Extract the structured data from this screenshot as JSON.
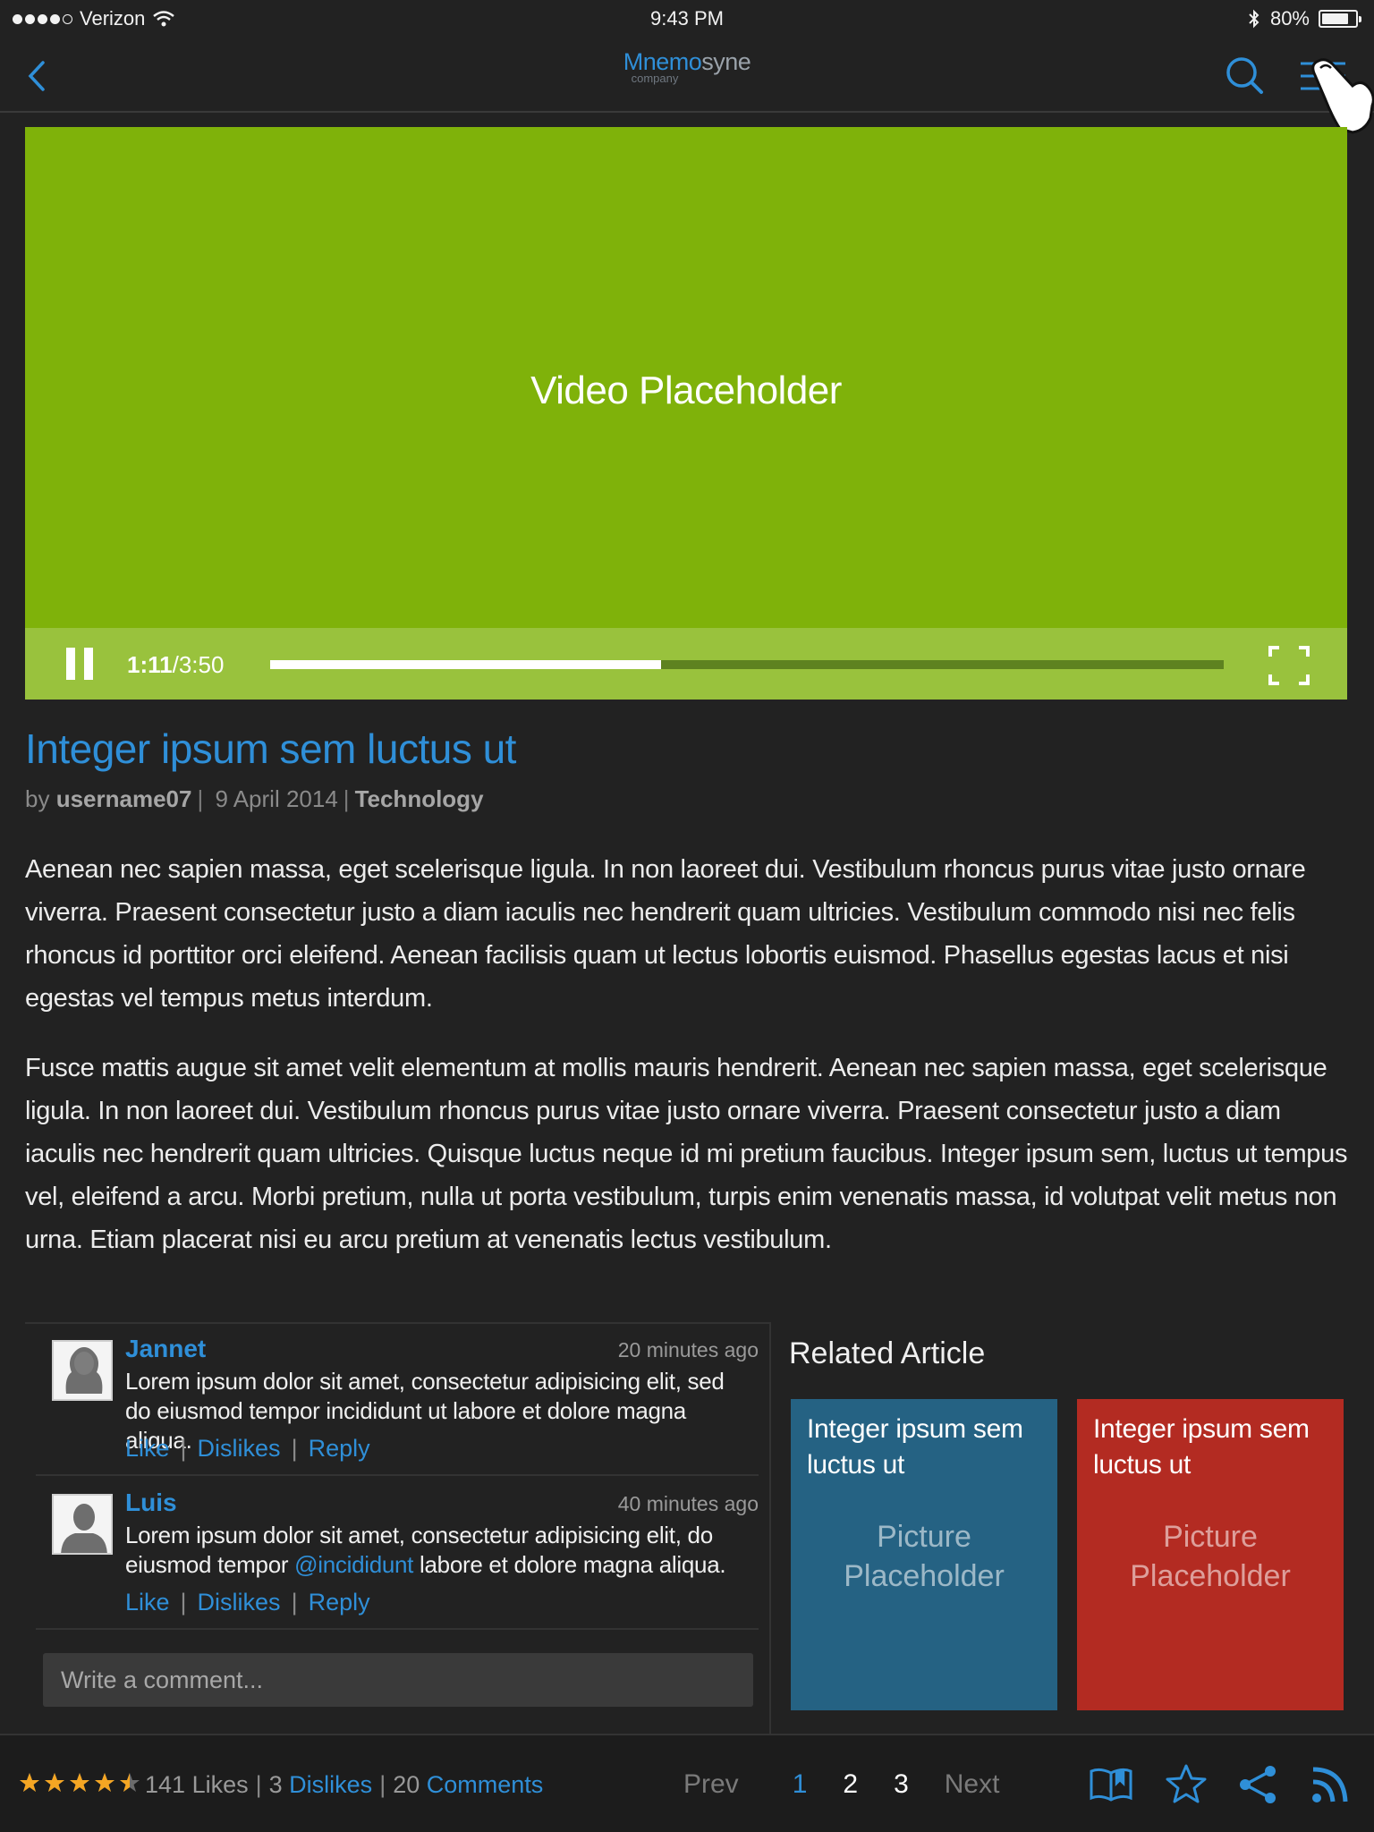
{
  "status_bar": {
    "carrier": "Verizon",
    "time": "9:43 PM",
    "battery": "80%",
    "battery_level": 0.8,
    "icons": [
      "wifi-icon",
      "bluetooth-icon",
      "battery-icon"
    ]
  },
  "nav": {
    "logo_part1": "Mnemo",
    "logo_part2": "syne",
    "logo_sub": "company",
    "icons": [
      "back-chevron-icon",
      "search-icon",
      "hamburger-menu-icon",
      "pointing-hand-icon"
    ]
  },
  "video": {
    "label": "Video Placeholder",
    "current_time": "1:11",
    "duration": "/3:50",
    "progress": 0.41,
    "background_color": "#7fb20a"
  },
  "article": {
    "title": "Integer ipsum sem luctus ut",
    "by": "by",
    "author": "username07",
    "date": "9 April 2014",
    "category": "Technology",
    "paragraphs": [
      "Aenean nec sapien massa, eget scelerisque ligula. In non laoreet dui. Vestibulum rhoncus purus vitae justo ornare viverra. Praesent consectetur justo a diam iaculis nec hendrerit quam ultricies. Vestibulum commodo nisi nec felis rhoncus id porttitor orci eleifend. Aenean facilisis quam ut lectus lobortis euismod. Phasellus egestas lacus et nisi egestas vel tempus metus interdum.",
      "Fusce mattis augue sit amet velit elementum at mollis mauris hendrerit. Aenean nec sapien massa, eget scelerisque ligula. In non laoreet dui. Vestibulum rhoncus purus vitae justo ornare viverra. Praesent consectetur justo a diam iaculis nec hendrerit quam ultricies. Quisque luctus neque id mi pretium faucibus. Integer ipsum sem, luctus ut tempus vel, eleifend a arcu. Morbi pretium, nulla ut porta vestibulum, turpis enim venenatis massa, id volutpat velit metus non urna. Etiam placerat nisi eu arcu pretium at venenatis lectus vestibulum."
    ]
  },
  "comments": [
    {
      "name": "Jannet",
      "time": "20 minutes ago",
      "text": "Lorem ipsum dolor sit amet, consectetur adipisicing elit, sed do eiusmod tempor incididunt ut labore et dolore magna aliqua.",
      "like": "Like",
      "dislikes": "Dislikes",
      "reply": "Reply",
      "avatar": "female-avatar-icon"
    },
    {
      "name": "Luis",
      "time": "40 minutes ago",
      "text_before": "Lorem ipsum dolor sit amet, consectetur adipisicing elit, do eiusmod tempor ",
      "mention": "@incididunt",
      "text_after": " labore et dolore magna aliqua.",
      "like": "Like",
      "dislikes": "Dislikes",
      "reply": "Reply",
      "avatar": "male-avatar-icon"
    }
  ],
  "comment_input": {
    "placeholder": "Write a comment..."
  },
  "related": {
    "heading": "Related Article",
    "cards": [
      {
        "title": "Integer ipsum sem luctus ut",
        "picture_line1": "Picture",
        "picture_line2": "Placeholder",
        "color": "#256283"
      },
      {
        "title": "Integer ipsum sem luctus ut",
        "picture_line1": "Picture",
        "picture_line2": "Placeholder",
        "color": "#b32b22"
      }
    ]
  },
  "footer": {
    "rating": 4.5,
    "rating_max": 5,
    "likes_count": "141",
    "likes_label": "Likes",
    "dislikes_count": "3",
    "dislikes_label": "Dislikes",
    "comments_count": "20",
    "comments_label": "Comments",
    "pagination": {
      "prev": "Prev",
      "pages": [
        "1",
        "2",
        "3"
      ],
      "next": "Next",
      "current": "1"
    },
    "icons": [
      "open-book-icon",
      "star-outline-icon",
      "share-icon",
      "rss-icon"
    ]
  },
  "colors": {
    "accent": "#2f8fd8",
    "background": "#222222",
    "star": "#f5a623"
  }
}
